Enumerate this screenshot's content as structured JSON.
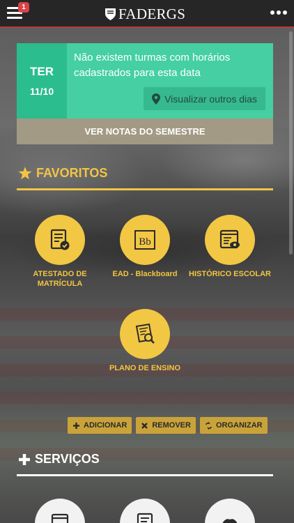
{
  "header": {
    "brand_name": "FADERGS",
    "notification_count": "1",
    "icons": [
      "hamburger-menu-icon",
      "shield-logo-icon",
      "more-options-icon"
    ]
  },
  "schedule": {
    "day_name": "TER",
    "date": "11/10",
    "message": "Não existem turmas com horários cadastrados para esta data",
    "other_days_label": "Visualizar outros dias"
  },
  "notes_button": "VER NOTAS DO SEMESTRE",
  "favorites": {
    "title": "FAVORITOS",
    "items": [
      {
        "label": "ATESTADO DE MATRÍCULA",
        "icon": "certificate-icon"
      },
      {
        "label": "EAD - Blackboard",
        "icon": "blackboard-icon"
      },
      {
        "label": "HISTÓRICO ESCOLAR",
        "icon": "transcript-icon"
      },
      {
        "label": "PLANO DE ENSINO",
        "icon": "teaching-plan-icon"
      }
    ],
    "actions": {
      "add": "ADICIONAR",
      "remove": "REMOVER",
      "organize": "ORGANIZAR"
    }
  },
  "services": {
    "title": "SERVIÇOS"
  },
  "colors": {
    "accent_yellow": "#f3c543",
    "teal": "#45cfa3",
    "teal_dark": "#2bbd8d",
    "topbar": "#262626",
    "badge_red": "#d9434a"
  }
}
